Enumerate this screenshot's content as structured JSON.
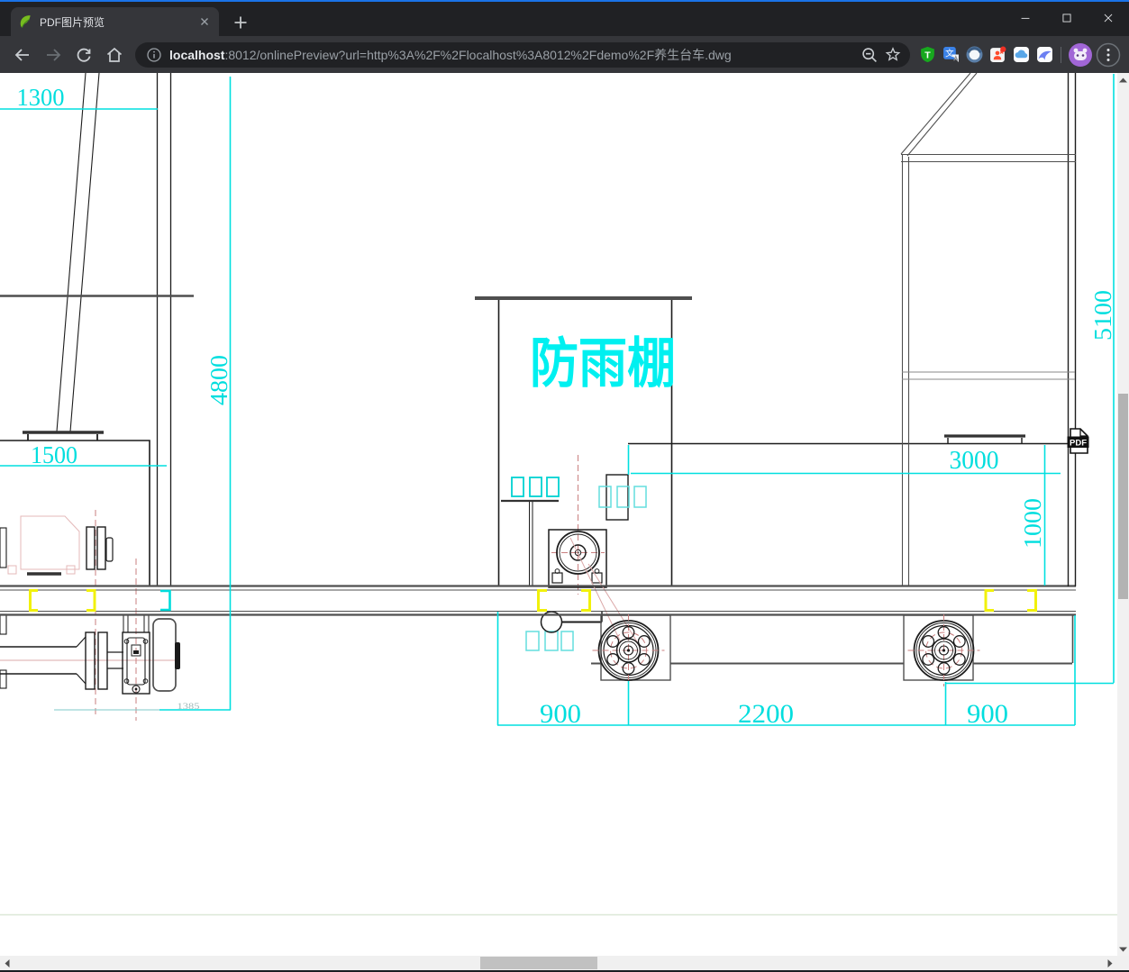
{
  "tab": {
    "title": "PDF图片预览"
  },
  "address_bar": {
    "host": "localhost",
    "path": ":8012/onlinePreview?url=http%3A%2F%2Flocalhost%3A8012%2Fdemo%2F养生台车.dwg"
  },
  "toolbar": {
    "extensions": [
      {
        "name": "tampermonkey",
        "glyph": "T"
      },
      {
        "name": "translate",
        "glyph": "文"
      },
      {
        "name": "orbit-circle",
        "glyph": ""
      },
      {
        "name": "helper-badge",
        "glyph": ""
      },
      {
        "name": "cloud",
        "glyph": ""
      },
      {
        "name": "thunder-bird",
        "glyph": ""
      }
    ]
  },
  "drawing": {
    "shelter_label": "防雨棚",
    "pdf_badge_label": "PDF",
    "dimensions": {
      "top_width": "1300",
      "left_height": "4800",
      "box_width": "1500",
      "axle_span": "1385",
      "platform_width": "3000",
      "platform_height": "1000",
      "total_height": "5100",
      "left_wheel_offset": "900",
      "wheel_spacing": "2200",
      "right_wheel_offset": "900"
    },
    "colors": {
      "dimension_cyan": "#00dfdf",
      "highlight_yellow": "#f1f10c",
      "centerline_red": "#c97f7f"
    }
  }
}
